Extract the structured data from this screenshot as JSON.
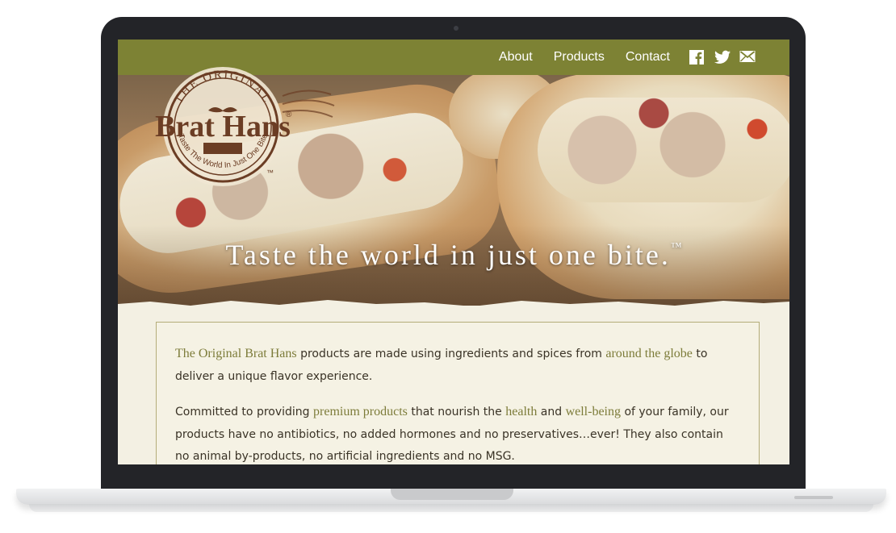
{
  "nav": {
    "items": [
      "About",
      "Products",
      "Contact"
    ]
  },
  "social": {
    "icons": [
      "facebook-icon",
      "twitter-icon",
      "mail-icon"
    ]
  },
  "logo": {
    "top": "THE ORIGINAL",
    "name": "Brat Hans",
    "tagline": "Taste The World In Just One Bite",
    "registered": "®",
    "trademark": "™"
  },
  "hero": {
    "tagline": "Taste the world in just one bite.",
    "tm": "™"
  },
  "content": {
    "p1": {
      "hl1": "The Original Brat Hans",
      "t1": " products are made using ingredients and spices from ",
      "hl2": "around the globe",
      "t2": " to deliver a unique flavor experience."
    },
    "p2": {
      "t1": "Committed to providing ",
      "hl1": "premium products",
      "t2": " that nourish the ",
      "hl2": "health",
      "t3": " and ",
      "hl3": "well-being",
      "t4": " of your family, our products have no antibiotics, no added hormones and no preservatives…ever! They also contain no animal by-products, no artificial ingredients and no MSG."
    }
  },
  "colors": {
    "topbar": "#7d8234",
    "accent_text": "#7d7c3a",
    "card_border": "#b4ac79",
    "page_bg": "#f3f0e3",
    "device_frame": "#232428"
  }
}
